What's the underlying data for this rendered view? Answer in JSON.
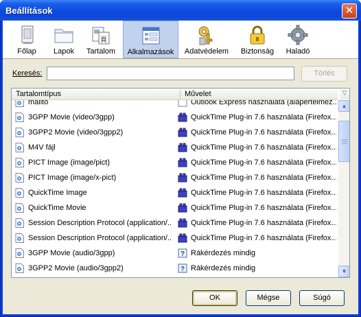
{
  "window": {
    "title": "Beállítások"
  },
  "toolbar": {
    "items": [
      {
        "label": "Főlap",
        "icon": "window-icon",
        "selected": false
      },
      {
        "label": "Lapok",
        "icon": "folder-icon",
        "selected": false
      },
      {
        "label": "Tartalom",
        "icon": "content-icon",
        "selected": false
      },
      {
        "label": "Alkalmazások",
        "icon": "applications-icon",
        "selected": true
      },
      {
        "label": "Adatvédelem",
        "icon": "key-icon",
        "selected": false
      },
      {
        "label": "Biztonság",
        "icon": "lock-icon",
        "selected": false
      },
      {
        "label": "Haladó",
        "icon": "gear-icon",
        "selected": false
      }
    ]
  },
  "search": {
    "label": "Keresés:",
    "value": "",
    "clear_label": "Törlés"
  },
  "table": {
    "columns": [
      "Tartalomtípus",
      "Művelet"
    ],
    "rows": [
      {
        "type": "mailto",
        "action": "Outlook Express használata (alapértelmez...",
        "action_icon": "outlook"
      },
      {
        "type": "3GPP Movie (video/3gpp)",
        "action": "QuickTime Plug-in 7.6 használata (Firefox...",
        "action_icon": "plugin"
      },
      {
        "type": "3GPP2 Movie (video/3gpp2)",
        "action": "QuickTime Plug-in 7.6 használata (Firefox...",
        "action_icon": "plugin"
      },
      {
        "type": "M4V fájl",
        "action": "QuickTime Plug-in 7.6 használata (Firefox...",
        "action_icon": "plugin"
      },
      {
        "type": "PICT Image (image/pict)",
        "action": "QuickTime Plug-in 7.6 használata (Firefox...",
        "action_icon": "plugin"
      },
      {
        "type": "PICT Image (image/x-pict)",
        "action": "QuickTime Plug-in 7.6 használata (Firefox...",
        "action_icon": "plugin"
      },
      {
        "type": "QuickTime Image",
        "action": "QuickTime Plug-in 7.6 használata (Firefox...",
        "action_icon": "plugin"
      },
      {
        "type": "QuickTime Movie",
        "action": "QuickTime Plug-in 7.6 használata (Firefox...",
        "action_icon": "plugin"
      },
      {
        "type": "Session Description Protocol (application/...",
        "action": "QuickTime Plug-in 7.6 használata (Firefox...",
        "action_icon": "plugin"
      },
      {
        "type": "Session Description Protocol (application/...",
        "action": "QuickTime Plug-in 7.6 használata (Firefox...",
        "action_icon": "plugin"
      },
      {
        "type": "3GPP Movie (audio/3gpp)",
        "action": "Rákérdezés mindig",
        "action_icon": "ask"
      },
      {
        "type": "3GPP2 Movie (audio/3gpp2)",
        "action": "Rákérdezés mindig",
        "action_icon": "ask"
      }
    ]
  },
  "buttons": {
    "ok": "OK",
    "cancel": "Mégse",
    "help": "Súgó"
  }
}
